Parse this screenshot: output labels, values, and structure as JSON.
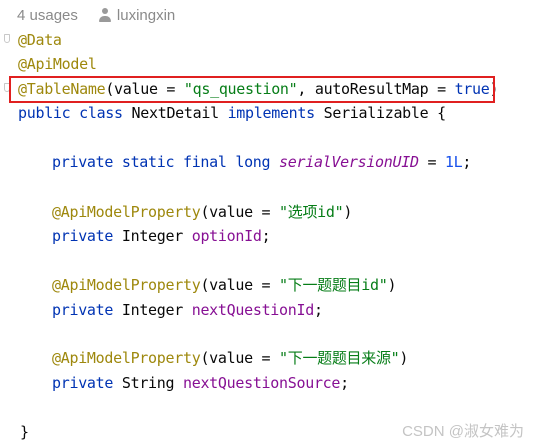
{
  "header": {
    "usages": "4 usages",
    "author": "luxingxin"
  },
  "code": {
    "line1": "@Data",
    "line2": "@ApiModel",
    "line3": {
      "annotation": "@TableName",
      "p1": "(value = ",
      "table_name": "\"qs_question\"",
      "p2": ", autoResultMap = ",
      "bool": "true",
      "p3": ")"
    },
    "line4": {
      "kw1": "public class ",
      "class_name": "NextDetail ",
      "kw2": "implements ",
      "iface": "Serializable {"
    },
    "line5": {
      "kw": "private static final long ",
      "name": "serialVersionUID",
      "eq": " = ",
      "val": "1L",
      "semi": ";"
    },
    "field1": {
      "annotation": "@ApiModelProperty",
      "p1": "(value = ",
      "value": "\"选项id\"",
      "p2": ")",
      "kw": "private ",
      "type": "Integer ",
      "name": "optionId",
      "semi": ";"
    },
    "field2": {
      "annotation": "@ApiModelProperty",
      "p1": "(value = ",
      "value": "\"下一题题目id\"",
      "p2": ")",
      "kw": "private ",
      "type": "Integer ",
      "name": "nextQuestionId",
      "semi": ";"
    },
    "field3": {
      "annotation": "@ApiModelProperty",
      "p1": "(value = ",
      "value": "\"下一题题目来源\"",
      "p2": ")",
      "kw": "private ",
      "type": "String ",
      "name": "nextQuestionSource",
      "semi": ";"
    },
    "closing": "}"
  },
  "watermark": "CSDN @淑女难为",
  "colors": {
    "annotation": "#9e880d",
    "keyword": "#0033b3",
    "string": "#067d17",
    "field": "#871094",
    "number": "#1750eb",
    "highlight_border": "#e02020"
  }
}
